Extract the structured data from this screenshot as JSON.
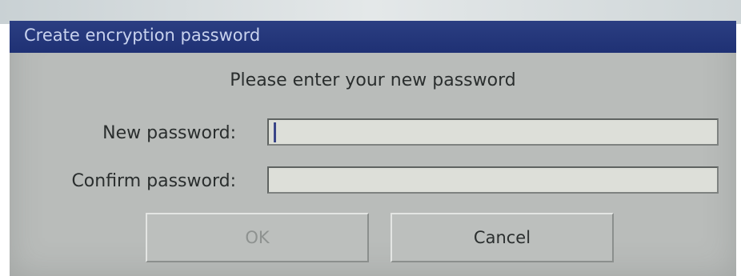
{
  "dialog": {
    "title": "Create encryption password",
    "heading": "Please enter your new password",
    "fields": {
      "new_password_label": "New password:",
      "new_password_value": "",
      "confirm_password_label": "Confirm password:",
      "confirm_password_value": ""
    },
    "buttons": {
      "ok_label": "OK",
      "ok_enabled": false,
      "cancel_label": "Cancel"
    }
  },
  "colors": {
    "titlebar": "#22347a",
    "title_text": "#c8d2ee",
    "dialog_background": "#b9bcba",
    "input_background": "#dddfd9",
    "disabled_text": "#8e9290"
  }
}
